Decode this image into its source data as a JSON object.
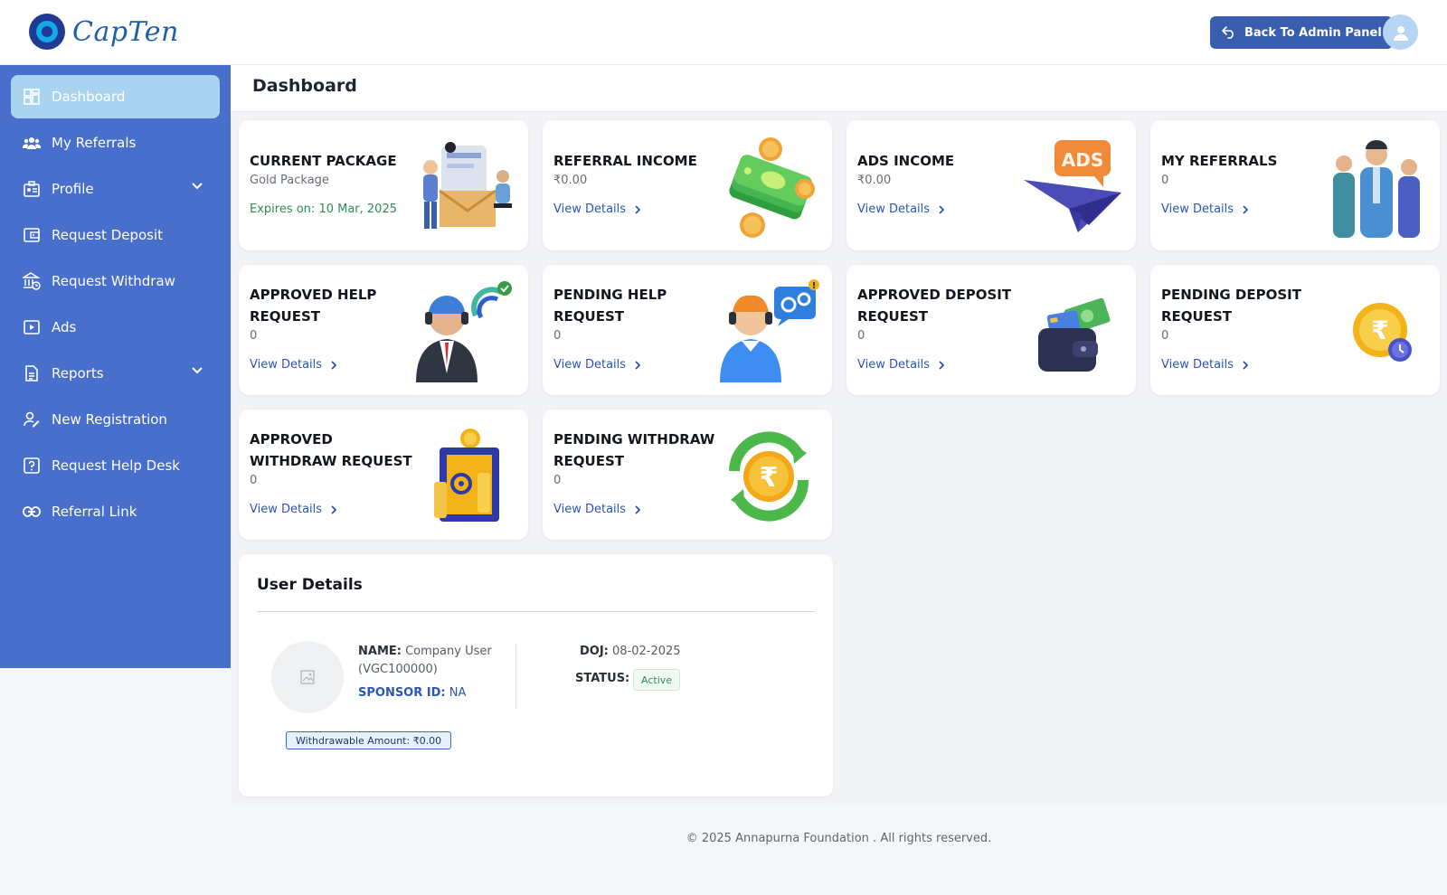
{
  "header": {
    "brand": "CapTen",
    "admin_button": "Back To Admin Panel"
  },
  "sidebar": {
    "items": [
      {
        "label": "Dashboard"
      },
      {
        "label": "My Referrals"
      },
      {
        "label": "Profile"
      },
      {
        "label": "Request Deposit"
      },
      {
        "label": "Request Withdraw"
      },
      {
        "label": "Ads"
      },
      {
        "label": "Reports"
      },
      {
        "label": "New Registration"
      },
      {
        "label": "Request Help Desk"
      },
      {
        "label": "Referral Link"
      }
    ]
  },
  "page": {
    "title": "Dashboard"
  },
  "cards": [
    {
      "title": "CURRENT PACKAGE",
      "value": "Gold Package",
      "extra": "Expires on: 10 Mar, 2025"
    },
    {
      "title": "REFERRAL INCOME",
      "value": "₹0.00",
      "link": "View Details"
    },
    {
      "title": "ADS INCOME",
      "value": "₹0.00",
      "link": "View Details"
    },
    {
      "title": "MY REFERRALS",
      "value": "0",
      "link": "View Details"
    },
    {
      "title": "APPROVED HELP REQUEST",
      "value": "0",
      "link": "View Details"
    },
    {
      "title": "PENDING HELP REQUEST",
      "value": "0",
      "link": "View Details"
    },
    {
      "title": "APPROVED DEPOSIT REQUEST",
      "value": "0",
      "link": "View Details"
    },
    {
      "title": "PENDING DEPOSIT REQUEST",
      "value": "0",
      "link": "View Details"
    },
    {
      "title": "APPROVED WITHDRAW REQUEST",
      "value": "0",
      "link": "View Details"
    },
    {
      "title": "PENDING WITHDRAW REQUEST",
      "value": "0",
      "link": "View Details"
    }
  ],
  "user_details": {
    "title": "User Details",
    "name_label": "NAME:",
    "name_value": "Company User",
    "user_id": "(VGC100000)",
    "sponsor_label": "SPONSOR ID:",
    "sponsor_value": "NA",
    "doj_label": "DOJ:",
    "doj_value": "08-02-2025",
    "status_label": "STATUS:",
    "status_value": "Active",
    "withdrawable": "Withdrawable Amount: ₹0.00"
  },
  "footer": {
    "text": "© 2025 Annapurna Foundation . All rights reserved."
  },
  "colors": {
    "sidebar": "#486fcb",
    "sidebar_active": "#a8d4f0",
    "link": "#2b57b0",
    "admin_button": "#3a5eaf",
    "success": "#2e8b57"
  }
}
